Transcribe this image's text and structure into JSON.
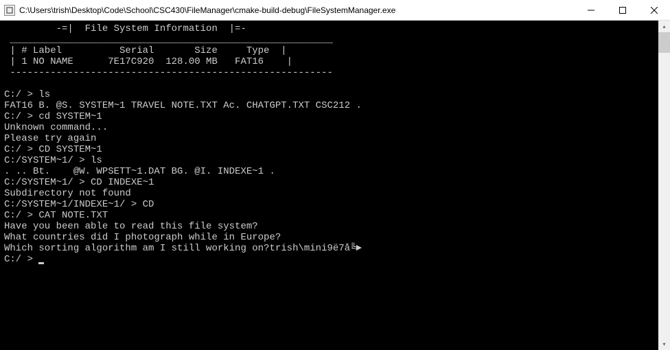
{
  "titlebar": {
    "path": "C:\\Users\\trish\\Desktop\\Code\\School\\CSC430\\FileManager\\cmake-build-debug\\FileSystemManager.exe"
  },
  "console": {
    "header": "         -=|  File System Information  |=-",
    "divider1": " ________________________________________________________",
    "table_header": " | # Label          Serial       Size     Type  |",
    "table_row": " | 1 NO NAME      7E17C920  128.00 MB   FAT16    |",
    "divider2": " --------------------------------------------------------",
    "lines": [
      "C:/ > ls",
      "FAT16 B. @S. SYSTEM~1 TRAVEL NOTE.TXT Ac. CHATGPT.TXT CSC212 .",
      "C:/ > cd SYSTEM~1",
      "Unknown command...",
      "Please try again",
      "C:/ > CD SYSTEM~1",
      "C:/SYSTEM~1/ > ls",
      ". .. Bt.    @W. WPSETT~1.DAT BG. @I. INDEXE~1 .",
      "C:/SYSTEM~1/ > CD INDEXE~1",
      "Subdirectory not found",
      "C:/SYSTEM~1/INDEXE~1/ > CD",
      "C:/ > CAT NOTE.TXT",
      "Have you been able to read this file system?",
      "What countries did I photograph while in Europe?",
      "Which sorting algorithm am I still working on?trish\\mini9ë7å╚►",
      "C:/ > "
    ]
  }
}
